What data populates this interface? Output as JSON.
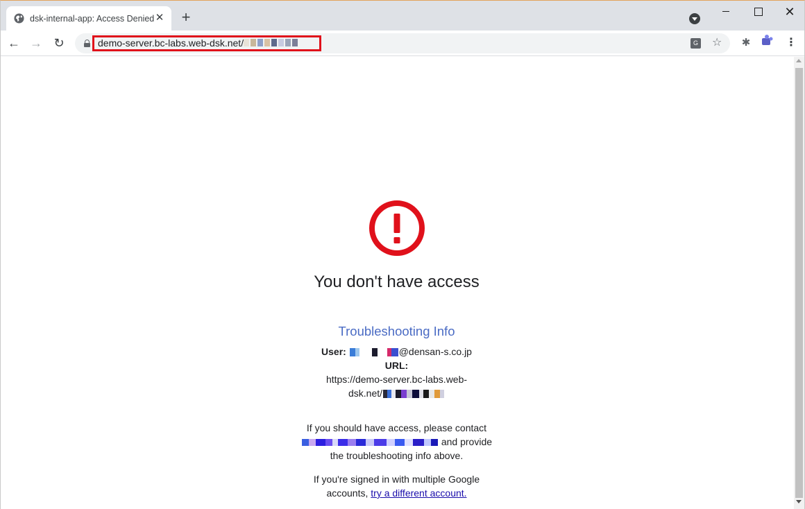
{
  "browser": {
    "tab_title": "dsk-internal-app: Access Denied",
    "url": "demo-server.bc-labs.web-dsk.net/",
    "colors": {
      "url_highlight": "#e0111b",
      "tab_strip": "#dee1e6"
    }
  },
  "page": {
    "title": "You don't have access",
    "alert_icon": "exclamation-circle-icon",
    "alert_color": "#e0111b",
    "troubleshooting_heading": "Troubleshooting Info",
    "user_label": "User:",
    "user_email_suffix": "@densan-s.co.jp",
    "url_label": "URL:",
    "url_value_line1": "https://demo-server.bc-labs.web-",
    "url_value_line2": "dsk.net/",
    "contact_message_line1": "If you should have access, please contact",
    "contact_message_line2": "and provide",
    "contact_message_line3": "the troubleshooting info above.",
    "multi_account_line1": "If you're signed in with multiple Google",
    "multi_account_prefix": "accounts,",
    "multi_account_link": "try a different account."
  }
}
